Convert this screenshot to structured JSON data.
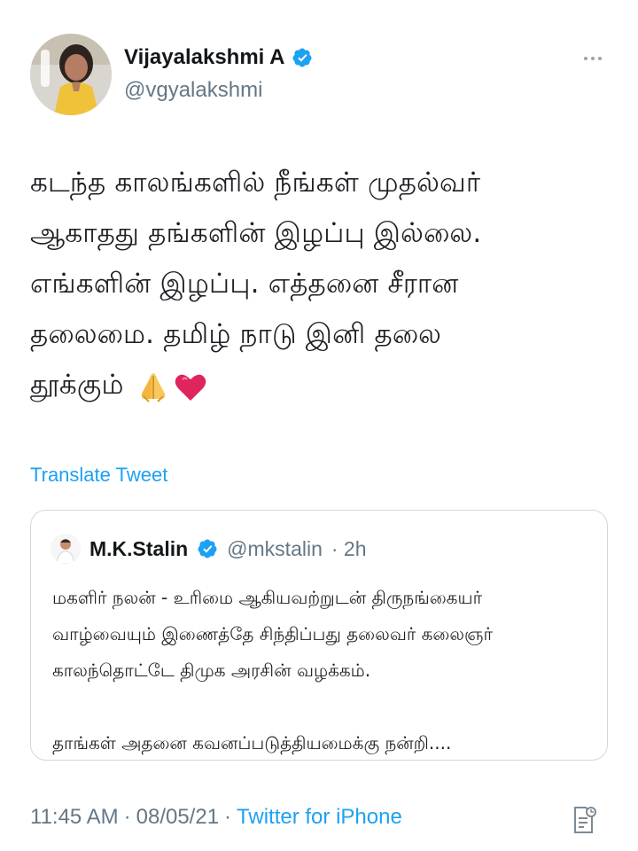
{
  "colors": {
    "accent": "#1da1f2",
    "verified_badge": "#1da1f2",
    "secondary_text": "#657786",
    "border": "#cfd9de",
    "emoji_hands": "#f4b63f",
    "emoji_heart": "#e0245e"
  },
  "author": {
    "display_name": "Vijayalakshmi A",
    "handle": "@vgyalakshmi",
    "verified": true,
    "avatar_icon": "profile-photo-avatar"
  },
  "tweet": {
    "lines": [
      "கடந்த காலங்களில் நீங்கள் முதல்வர்",
      "ஆகாதது தங்களின் இழப்பு இல்லை.",
      "எங்களின் இழப்பு. எத்தனை சீரான",
      "தலைமை. தமிழ் நாடு இனி தலை",
      "தூக்கும்"
    ],
    "emoji_icons": [
      "folded-hands-icon",
      "red-heart-icon"
    ],
    "translate_label": "Translate Tweet"
  },
  "quoted_tweet": {
    "display_name": "M.K.Stalin",
    "handle": "@mkstalin",
    "time": "· 2h",
    "verified": true,
    "lines": [
      "மகளிர் நலன் - உரிமை ஆகியவற்றுடன் திருநங்கையர்",
      "வாழ்வையும் இணைத்தே சிந்திப்பது தலைவர் கலைஞர்",
      "காலந்தொட்டே திமுக அரசின் வழக்கம்.",
      "தாங்கள் அதனை கவனப்படுத்தியமைக்கு நன்றி...."
    ]
  },
  "footer": {
    "time": "11:45 AM",
    "separator": "·",
    "date": "08/05/21",
    "source": "Twitter for iPhone",
    "analytics_icon": "tweet-analytics-icon"
  }
}
